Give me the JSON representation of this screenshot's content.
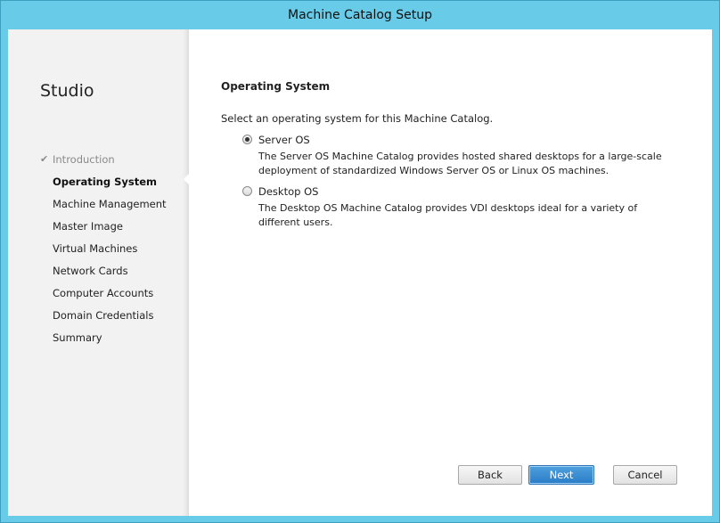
{
  "window": {
    "title": "Machine Catalog Setup"
  },
  "sidebar": {
    "title": "Studio",
    "steps": [
      {
        "label": "Introduction",
        "state": "done"
      },
      {
        "label": "Operating System",
        "state": "active"
      },
      {
        "label": "Machine Management",
        "state": "pending"
      },
      {
        "label": "Master Image",
        "state": "pending"
      },
      {
        "label": "Virtual Machines",
        "state": "pending"
      },
      {
        "label": "Network Cards",
        "state": "pending"
      },
      {
        "label": "Computer Accounts",
        "state": "pending"
      },
      {
        "label": "Domain Credentials",
        "state": "pending"
      },
      {
        "label": "Summary",
        "state": "pending"
      }
    ]
  },
  "main": {
    "heading": "Operating System",
    "instruction": "Select an operating system for this Machine Catalog.",
    "options": [
      {
        "label": "Server OS",
        "selected": true,
        "description": "The Server OS Machine Catalog provides hosted shared desktops for a large-scale deployment of standardized Windows Server OS or Linux OS machines."
      },
      {
        "label": "Desktop OS",
        "selected": false,
        "description": "The Desktop OS Machine Catalog provides VDI desktops ideal for a variety of different users."
      }
    ]
  },
  "buttons": {
    "back": "Back",
    "next": "Next",
    "cancel": "Cancel"
  },
  "colors": {
    "titlebar": "#68cbe8",
    "primary_button": "#2a7cc7"
  }
}
